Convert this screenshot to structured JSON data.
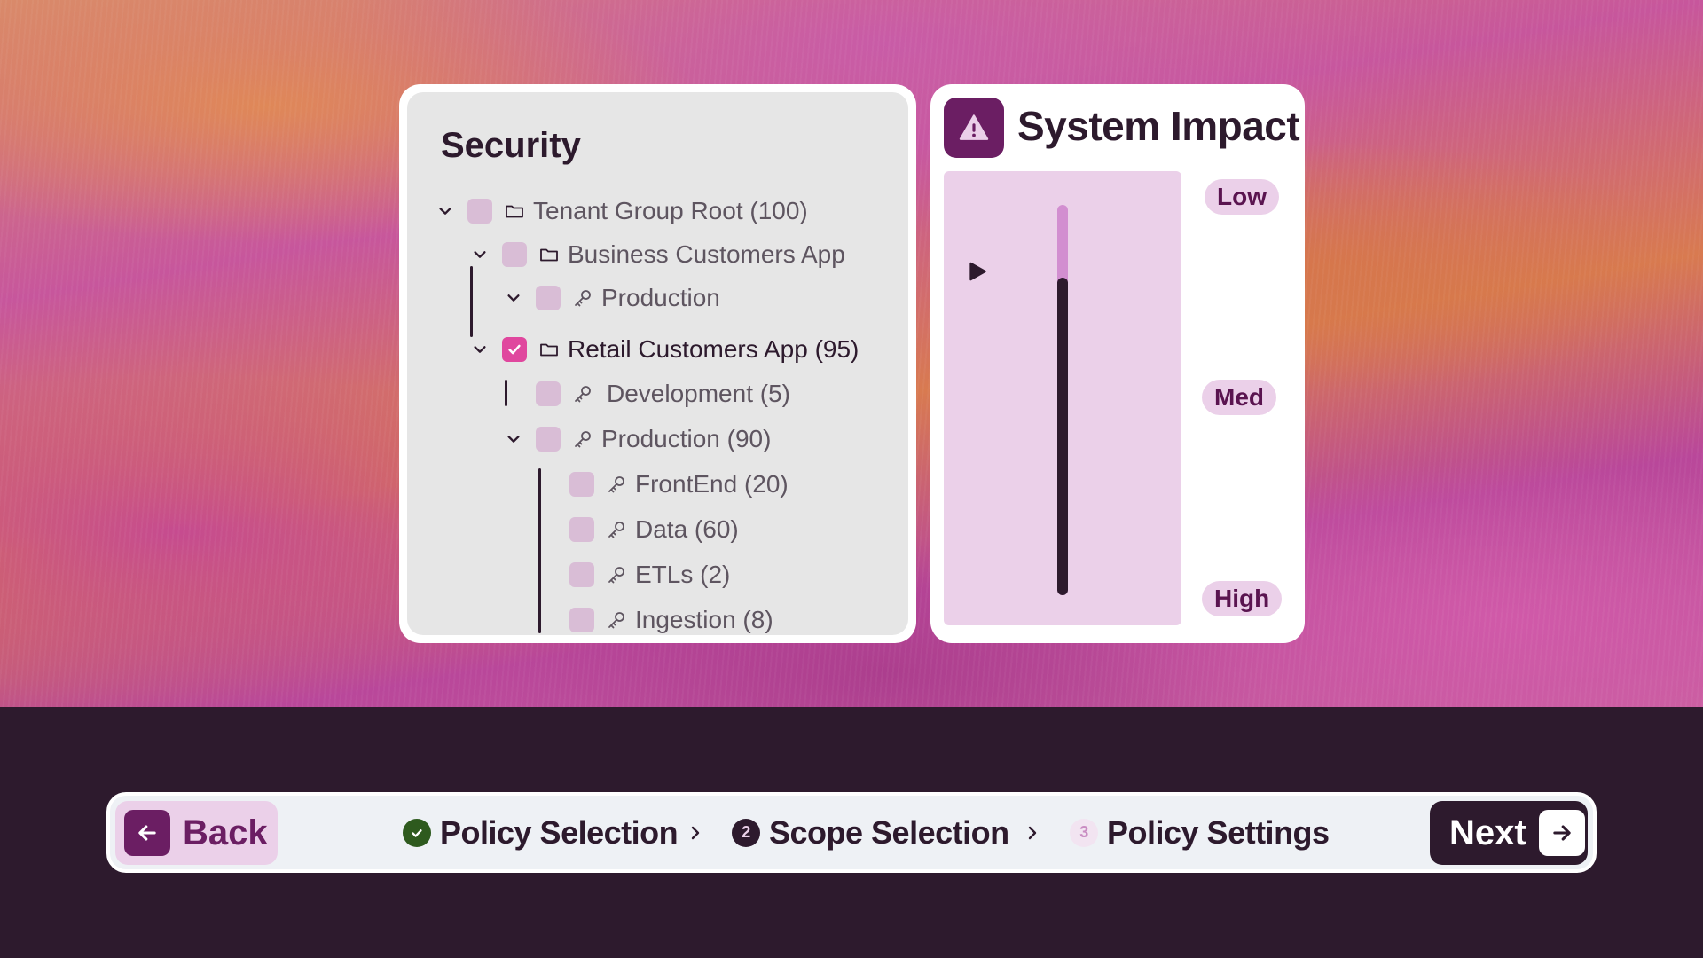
{
  "security": {
    "title": "Security",
    "tree": [
      {
        "label": "Tenant Group Root (100)",
        "icon": "folder-icon",
        "checked": false,
        "expanded": true
      },
      {
        "label": "Business Customers App",
        "icon": "folder-icon",
        "checked": false,
        "expanded": true
      },
      {
        "label": "Production",
        "icon": "key-icon",
        "checked": false,
        "expanded": true
      },
      {
        "label": "Retail Customers App (95)",
        "icon": "folder-icon",
        "checked": true,
        "expanded": true
      },
      {
        "label": "Development (5)",
        "icon": "key-icon",
        "checked": false
      },
      {
        "label": "Production (90)",
        "icon": "key-icon",
        "checked": false,
        "expanded": true
      },
      {
        "label": "FrontEnd (20)",
        "icon": "key-icon",
        "checked": false
      },
      {
        "label": "Data (60)",
        "icon": "key-icon",
        "checked": false
      },
      {
        "label": "ETLs (2)",
        "icon": "key-icon",
        "checked": false
      },
      {
        "label": "Ingestion (8)",
        "icon": "key-icon",
        "checked": false
      }
    ]
  },
  "impact": {
    "title": "System Impact",
    "icon": "warning-icon",
    "levels": [
      "Low",
      "Med",
      "High"
    ],
    "slider_fill_fraction": 0.81
  },
  "wizard": {
    "back_label": "Back",
    "next_label": "Next",
    "steps": [
      {
        "label": "Policy Selection",
        "state": "done"
      },
      {
        "label": "Scope Selection",
        "state": "current",
        "number": "2"
      },
      {
        "label": "Policy Settings",
        "state": "future",
        "number": "3"
      }
    ]
  },
  "colors": {
    "accent": "#6b1e63",
    "dark": "#2d1a2d",
    "checkbox_checked": "#e0479e",
    "light_pink": "#ebd0e9"
  }
}
